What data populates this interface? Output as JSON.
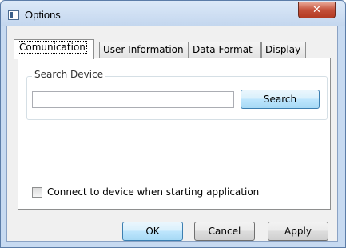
{
  "window": {
    "title": "Options",
    "close_glyph": "✕"
  },
  "tabs": [
    {
      "label": "Comunication",
      "active": true
    },
    {
      "label": "User Information",
      "active": false
    },
    {
      "label": "Data Format",
      "active": false
    },
    {
      "label": "Display",
      "active": false
    }
  ],
  "communication": {
    "group_label": "Search Device",
    "search_value": "",
    "search_button": "Search",
    "connect_checkbox_label": "Connect to device when starting application",
    "connect_checked": false
  },
  "footer": {
    "ok": "OK",
    "cancel": "Cancel",
    "apply": "Apply"
  },
  "icons": {
    "window": "app-window-icon",
    "close": "close-icon"
  }
}
